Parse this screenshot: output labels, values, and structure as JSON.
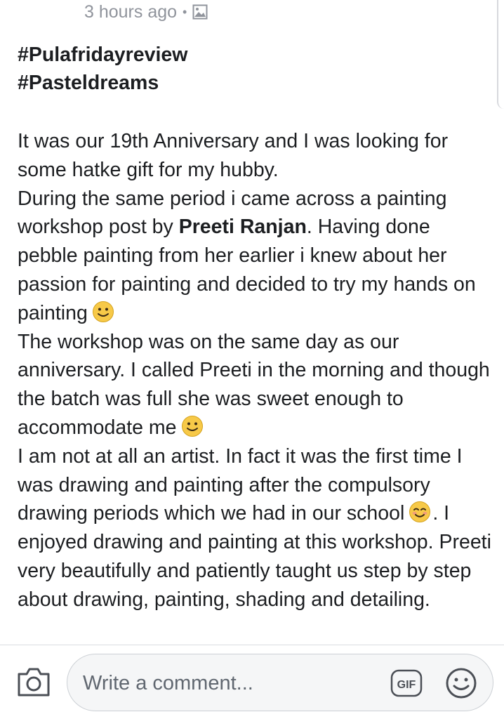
{
  "post": {
    "timestamp": "3 hours ago",
    "separator": "•",
    "tags": [
      "#Pulafridayreview",
      "#Pasteldreams"
    ],
    "paragraph1_a": "It was our 19th Anniversary and I was looking for some hatke gift for my hubby.",
    "paragraph1_b": "During the same period i came across a painting workshop post by ",
    "mention": "Preeti Ranjan",
    "paragraph1_c": ". Having done pebble painting from her earlier i knew about her passion for painting and decided to try my hands on painting",
    "paragraph2": "The workshop was on the same day as our anniversary. I called Preeti in the morning and though the batch was full she was sweet enough to accommodate me",
    "paragraph3_a": "I am not at all an artist. In fact it was the first time I was drawing and painting after the compulsory drawing periods which we had in our school",
    "paragraph3_b": ". I enjoyed  drawing and painting at this workshop. Preeti very beautifully and patiently taught us step by step about drawing, painting, shading and detailing."
  },
  "comment_bar": {
    "placeholder": "Write a comment...",
    "gif_label": "GIF"
  },
  "icons": {
    "privacy": "photo-icon",
    "camera": "camera-icon",
    "gif": "gif-icon",
    "emoji": "smiley-icon"
  },
  "colors": {
    "text": "#1c1e21",
    "meta": "#90949c",
    "emoji_fill": "#f7c948",
    "input_bg": "#f5f6f7"
  }
}
